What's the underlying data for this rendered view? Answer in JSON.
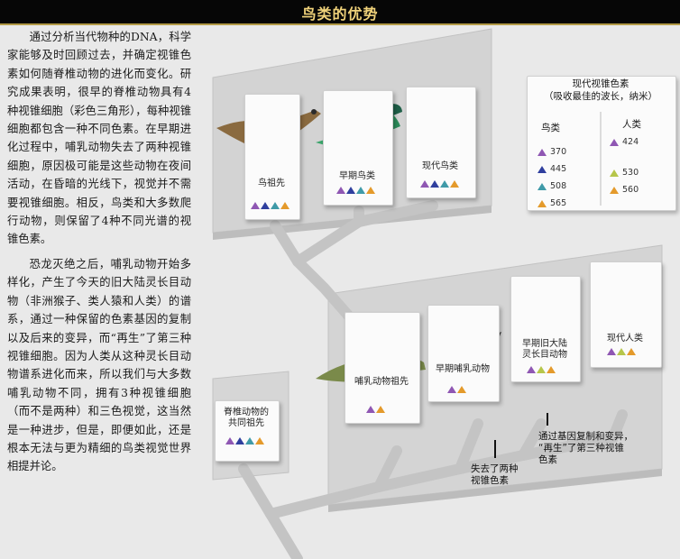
{
  "title": "鸟类的优势",
  "article": {
    "paragraphs": [
      "通过分析当代物种的DNA，科学家能够及时回顾过去，并确定视锥色素如何随脊椎动物的进化而变化。研究成果表明，很早的脊椎动物具有4种视锥细胞（彩色三角形），每种视锥细胞都包含一种不同色素。在早期进化过程中，哺乳动物失去了两种视锥细胞，原因极可能是这些动物在夜间活动，在昏暗的光线下，视觉并不需要视锥细胞。相反，鸟类和大多数爬行动物，则保留了4种不同光谱的视锥色素。",
      "恐龙灭绝之后，哺乳动物开始多样化，产生了今天的旧大陆灵长目动物（非洲猴子、类人猿和人类）的谱系，通过一种保留的色素基因的复制以及后来的变异，而“再生”了第三种视锥细胞。因为人类从这种灵长目动物谱系进化而来，所以我们与大多数哺乳动物不同，拥有3种视锥细胞（而不是两种）和三色视觉，这当然是一种进步，但是，即便如此，还是根本无法与更为精细的鸟类视觉世界相提并论。"
    ]
  },
  "legend": {
    "title_line1": "现代视锥色素",
    "title_line2": "（吸收最佳的波长，纳米）",
    "birds_title": "鸟类",
    "humans_title": "人类",
    "birds": [
      {
        "value": "370",
        "color": "#8f57b3"
      },
      {
        "value": "445",
        "color": "#2f3f9e"
      },
      {
        "value": "508",
        "color": "#3f9aa8"
      },
      {
        "value": "565",
        "color": "#e49a2b"
      }
    ],
    "humans": [
      {
        "value": "424",
        "color": "#8f57b3"
      },
      {
        "value": "530",
        "color": "#b6c64a"
      },
      {
        "value": "560",
        "color": "#e49a2b"
      }
    ]
  },
  "cards": {
    "bird_ancestor": "鸟祖先",
    "early_bird": "早期鸟类",
    "modern_bird": "现代鸟类",
    "mammal_ancestor": "哺乳动物祖先",
    "early_mammal": "早期哺乳动物",
    "early_primate_l1": "早期旧大陆",
    "early_primate_l2": "灵长目动物",
    "modern_human": "现代人类",
    "vertebrate_l1": "脊椎动物的",
    "vertebrate_l2": "共同祖先"
  },
  "annotations": {
    "lost_l1": "失去了两种",
    "lost_l2": "视锥色素",
    "regain_l1": "通过基因复制和变异，",
    "regain_l2": "“再生”了第三种视锥",
    "regain_l3": "色素"
  },
  "pigment_colors": {
    "violet": "#8f57b3",
    "blue": "#2f3f9e",
    "teal": "#3f9aa8",
    "orange": "#e49a2b",
    "green": "#b6c64a"
  }
}
